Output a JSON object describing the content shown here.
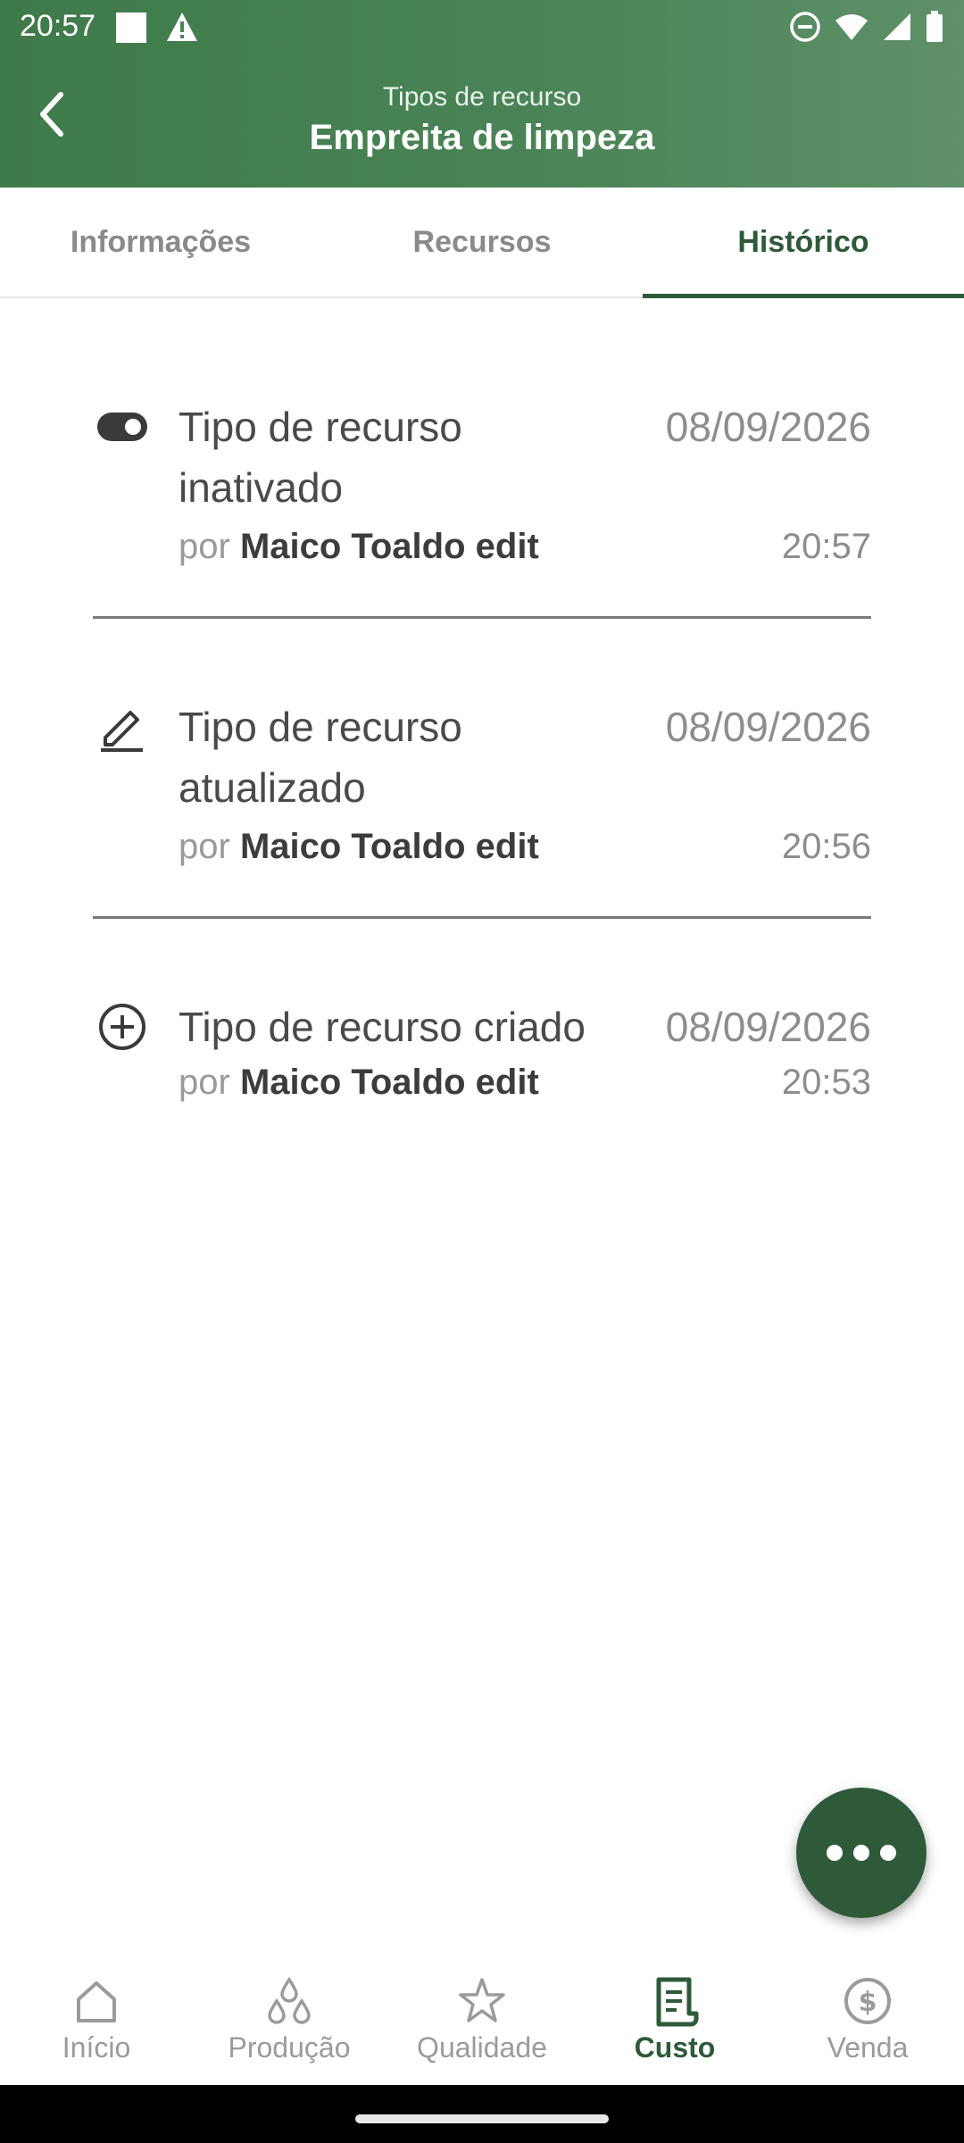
{
  "status_bar": {
    "time": "20:57"
  },
  "header": {
    "subtitle": "Tipos de recurso",
    "title": "Empreita de limpeza"
  },
  "tabs": [
    {
      "label": "Informações",
      "active": false
    },
    {
      "label": "Recursos",
      "active": false
    },
    {
      "label": "Histórico",
      "active": true
    }
  ],
  "history": [
    {
      "icon": "toggle-icon",
      "title": "Tipo de recurso inativado",
      "by_prefix": "por",
      "user": "Maico Toaldo edit",
      "date": "08/09/2026",
      "time": "20:57"
    },
    {
      "icon": "pencil-icon",
      "title": "Tipo de recurso atualizado",
      "by_prefix": "por",
      "user": "Maico Toaldo edit",
      "date": "08/09/2026",
      "time": "20:56"
    },
    {
      "icon": "plus-circle-icon",
      "title": "Tipo de recurso criado",
      "by_prefix": "por",
      "user": "Maico Toaldo edit",
      "date": "08/09/2026",
      "time": "20:53"
    }
  ],
  "bottom_nav": [
    {
      "label": "Início",
      "icon": "home-icon",
      "active": false
    },
    {
      "label": "Produção",
      "icon": "drops-icon",
      "active": false
    },
    {
      "label": "Qualidade",
      "icon": "star-icon",
      "active": false
    },
    {
      "label": "Custo",
      "icon": "receipt-icon",
      "active": true
    },
    {
      "label": "Venda",
      "icon": "dollar-circle-icon",
      "active": false
    }
  ],
  "colors": {
    "primary": "#2f5a3a",
    "header": "#4a8456",
    "muted_text": "#8d8d8d"
  }
}
